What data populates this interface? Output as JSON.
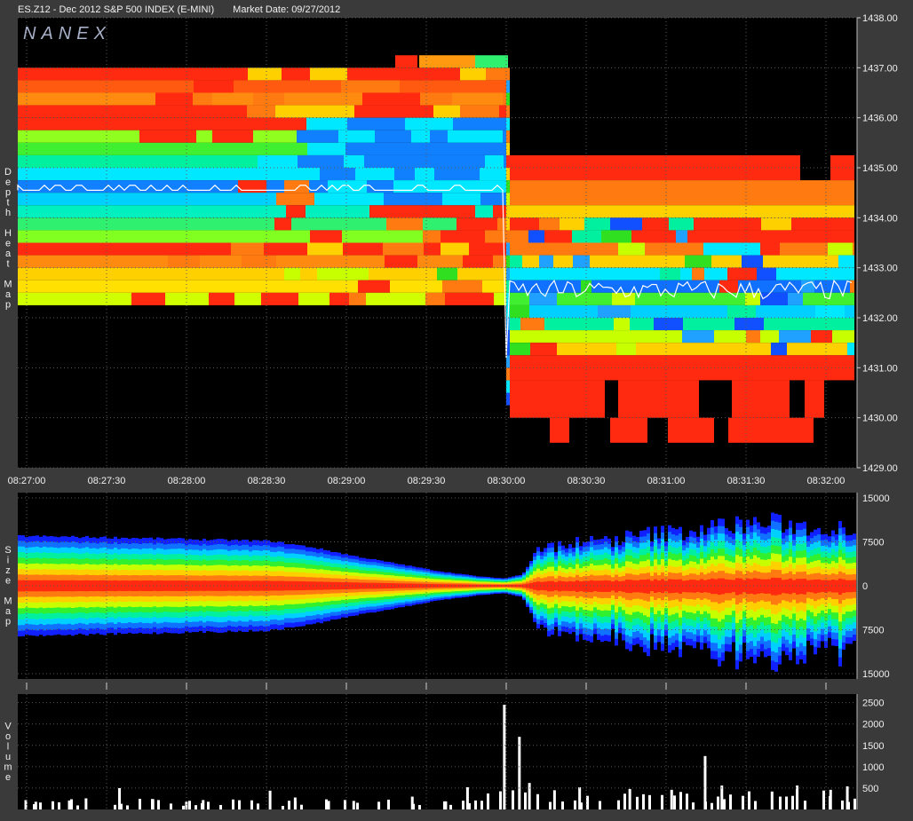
{
  "header": {
    "symbol": "ES.Z12 - Dec 2012 S&P 500 INDEX (E-MINI)",
    "market_date": "Market Date: 09/27/2012"
  },
  "watermark": "NANEX",
  "colors": {
    "background": "#000000",
    "frame": "#3a3a3a",
    "grid": "#5a5a5a",
    "price_line": "#ffffff",
    "volume_bar": "#ffffff",
    "heat_scale": [
      "#ff2a10",
      "#ff7a10",
      "#ffd000",
      "#c8ff00",
      "#30e020",
      "#00f0a0",
      "#00e8ff",
      "#20a0ff",
      "#1050ff"
    ]
  },
  "chart_data": [
    {
      "type": "heatmap",
      "panel_label": "Depth Heat Map",
      "x_ticks": [
        "08:27:00",
        "08:27:30",
        "08:28:00",
        "08:28:30",
        "08:29:00",
        "08:29:30",
        "08:30:00",
        "08:30:30",
        "08:31:00",
        "08:31:30",
        "08:32:00"
      ],
      "y_ticks": [
        "1438.00",
        "1437.00",
        "1436.00",
        "1435.00",
        "1434.00",
        "1433.00",
        "1432.00",
        "1431.00",
        "1430.00",
        "1429.00"
      ],
      "ylim": [
        1429,
        1438
      ],
      "bands_before": [
        {
          "from": 1436.75,
          "to": 1437.0,
          "color": "#ff2a10"
        },
        {
          "from": 1436.5,
          "to": 1436.75,
          "color": "#ff5a10"
        },
        {
          "from": 1436.25,
          "to": 1436.5,
          "color": "#ff8a10"
        },
        {
          "from": 1436.0,
          "to": 1436.25,
          "color": "#ff2a10"
        },
        {
          "from": 1435.75,
          "to": 1436.0,
          "color": "#ff2a10"
        },
        {
          "from": 1435.5,
          "to": 1435.75,
          "color": "#90ff20"
        },
        {
          "from": 1435.25,
          "to": 1435.5,
          "color": "#40f030"
        },
        {
          "from": 1435.0,
          "to": 1435.25,
          "color": "#00f0a0"
        },
        {
          "from": 1434.75,
          "to": 1435.0,
          "color": "#00e8ff"
        },
        {
          "from": 1434.5,
          "to": 1434.75,
          "color": "#1080ff"
        },
        {
          "from": 1434.25,
          "to": 1434.5,
          "color": "#00d0ff"
        },
        {
          "from": 1434.0,
          "to": 1434.25,
          "color": "#00f0c0"
        },
        {
          "from": 1433.75,
          "to": 1434.0,
          "color": "#30f070"
        },
        {
          "from": 1433.5,
          "to": 1433.75,
          "color": "#80ff20"
        },
        {
          "from": 1433.25,
          "to": 1433.5,
          "color": "#ff2a10"
        },
        {
          "from": 1433.0,
          "to": 1433.25,
          "color": "#ff8a10"
        },
        {
          "from": 1432.75,
          "to": 1433.0,
          "color": "#ffd000"
        },
        {
          "from": 1432.5,
          "to": 1432.75,
          "color": "#ffe000"
        },
        {
          "from": 1432.25,
          "to": 1432.5,
          "color": "#d0ff00"
        }
      ],
      "bands_after": [
        {
          "from": 1434.75,
          "to": 1435.25,
          "color": "#ff2a10"
        },
        {
          "from": 1434.25,
          "to": 1434.75,
          "color": "#ff7a10"
        },
        {
          "from": 1434.0,
          "to": 1434.25,
          "color": "#ffd000"
        },
        {
          "from": 1433.75,
          "to": 1434.0,
          "color": "#ff2a10"
        },
        {
          "from": 1433.5,
          "to": 1433.75,
          "color": "#ff2a10"
        },
        {
          "from": 1433.25,
          "to": 1433.5,
          "color": "#ff7a10"
        },
        {
          "from": 1433.0,
          "to": 1433.25,
          "color": "#ffd000"
        },
        {
          "from": 1432.75,
          "to": 1433.0,
          "color": "#00e8ff"
        },
        {
          "from": 1432.5,
          "to": 1432.75,
          "color": "#1070ff"
        },
        {
          "from": 1432.25,
          "to": 1432.5,
          "color": "#40f030"
        },
        {
          "from": 1432.0,
          "to": 1432.25,
          "color": "#00d0ff"
        },
        {
          "from": 1431.75,
          "to": 1432.0,
          "color": "#00f0a0"
        },
        {
          "from": 1431.5,
          "to": 1431.75,
          "color": "#c8ff00"
        },
        {
          "from": 1431.25,
          "to": 1431.5,
          "color": "#ffd000"
        },
        {
          "from": 1430.75,
          "to": 1431.25,
          "color": "#ff2a10"
        },
        {
          "from": 1430.0,
          "to": 1430.75,
          "color": "#ff2a10"
        },
        {
          "from": 1429.5,
          "to": 1430.0,
          "color": "#ff2a10"
        }
      ],
      "price_trace_before": 1434.55,
      "price_trace_after": 1432.55
    },
    {
      "type": "area",
      "panel_label": "Size Map",
      "y_ticks": [
        "15000",
        "7500",
        "0",
        "7500",
        "15000"
      ],
      "ylim": [
        -15000,
        15000
      ],
      "spread_profile_x": [
        0,
        0.1,
        0.2,
        0.3,
        0.35,
        0.4,
        0.45,
        0.5,
        0.55,
        0.58,
        0.6,
        0.62,
        0.65,
        0.7,
        0.75,
        0.8,
        0.85,
        0.9,
        0.95,
        1.0
      ],
      "spread_profile_y": [
        8000,
        7800,
        7500,
        7200,
        6200,
        4800,
        3600,
        2400,
        1500,
        1200,
        1800,
        5500,
        6500,
        7000,
        8000,
        8500,
        9500,
        9800,
        9000,
        9200
      ]
    },
    {
      "type": "bar",
      "panel_label": "Volume",
      "y_ticks": [
        "2500",
        "2000",
        "1500",
        "1000",
        "500"
      ],
      "ylim": [
        0,
        2700
      ],
      "spikes": [
        {
          "t": 0.008,
          "v": 220
        },
        {
          "t": 0.02,
          "v": 180
        },
        {
          "t": 0.06,
          "v": 210
        },
        {
          "t": 0.08,
          "v": 260
        },
        {
          "t": 0.12,
          "v": 500
        },
        {
          "t": 0.16,
          "v": 240
        },
        {
          "t": 0.2,
          "v": 180
        },
        {
          "t": 0.22,
          "v": 220
        },
        {
          "t": 0.3,
          "v": 440
        },
        {
          "t": 0.33,
          "v": 280
        },
        {
          "t": 0.37,
          "v": 200
        },
        {
          "t": 0.4,
          "v": 200
        },
        {
          "t": 0.43,
          "v": 180
        },
        {
          "t": 0.47,
          "v": 300
        },
        {
          "t": 0.51,
          "v": 190
        },
        {
          "t": 0.536,
          "v": 520
        },
        {
          "t": 0.58,
          "v": 2450
        },
        {
          "t": 0.598,
          "v": 1700
        },
        {
          "t": 0.61,
          "v": 620
        },
        {
          "t": 0.64,
          "v": 450
        },
        {
          "t": 0.67,
          "v": 520
        },
        {
          "t": 0.73,
          "v": 480
        },
        {
          "t": 0.78,
          "v": 460
        },
        {
          "t": 0.82,
          "v": 1250
        },
        {
          "t": 0.84,
          "v": 560
        },
        {
          "t": 0.9,
          "v": 420
        },
        {
          "t": 0.93,
          "v": 560
        },
        {
          "t": 0.97,
          "v": 460
        },
        {
          "t": 0.99,
          "v": 540
        }
      ]
    }
  ]
}
